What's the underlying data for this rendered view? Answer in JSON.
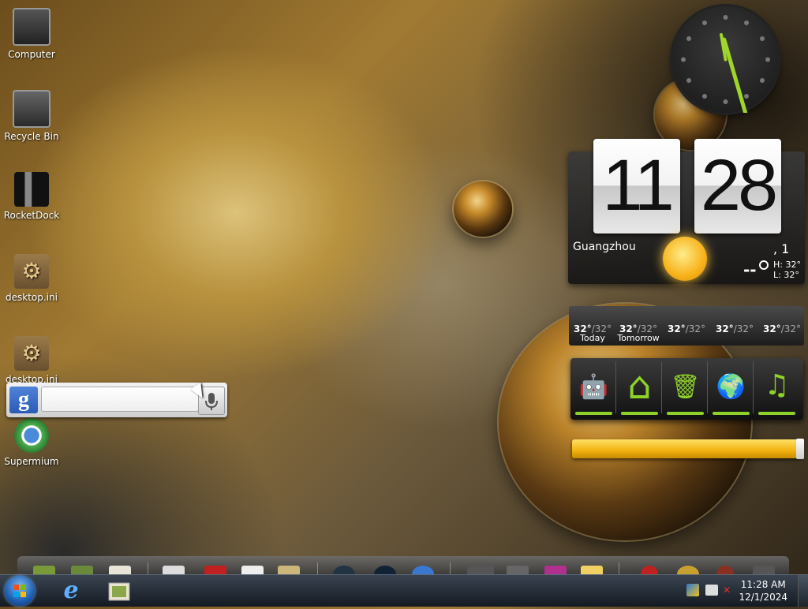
{
  "desktop": {
    "icons": [
      {
        "label": "Computer",
        "icon": "computer-icon"
      },
      {
        "label": "Recycle Bin",
        "icon": "recycle-bin-icon"
      },
      {
        "label": "RocketDock",
        "icon": "rocketdock-icon"
      },
      {
        "label": "desktop.ini",
        "icon": "gear-file-icon"
      },
      {
        "label": "desktop.ini",
        "icon": "gear-file-icon"
      },
      {
        "label": "Supermium",
        "icon": "supermium-browser-icon"
      }
    ]
  },
  "google_widget": {
    "logo_letter": "g",
    "search_value": "",
    "search_placeholder": ""
  },
  "clock_widget": {
    "hour": "11",
    "minute": "28",
    "city": "Guangzhou",
    "date_fragment": ", 1",
    "current_temp": "--",
    "high": "H: 32°",
    "low": "L: 32°"
  },
  "forecast": [
    {
      "hi": "32°",
      "lo": "/32°",
      "label": "Today"
    },
    {
      "hi": "32°",
      "lo": "/32°",
      "label": "Tomorrow"
    },
    {
      "hi": "32°",
      "lo": "/32°",
      "label": ""
    },
    {
      "hi": "32°",
      "lo": "/32°",
      "label": ""
    },
    {
      "hi": "32°",
      "lo": "/32°",
      "label": ""
    }
  ],
  "android_buttons": [
    {
      "icon": "android-icon",
      "glyph": "🤖"
    },
    {
      "icon": "home-icon",
      "glyph": "⌂"
    },
    {
      "icon": "trash-icon",
      "glyph": "🗑"
    },
    {
      "icon": "globe-icon",
      "glyph": "🌍"
    },
    {
      "icon": "music-icon",
      "glyph": "♫"
    }
  ],
  "slider": {
    "level": 1.0
  },
  "taskbar": {
    "time": "11:28 AM",
    "date": "12/1/2024",
    "ie_glyph": "e"
  },
  "colors": {
    "android_green": "#8ed12a",
    "slider_yellow": "#f2b10e"
  }
}
